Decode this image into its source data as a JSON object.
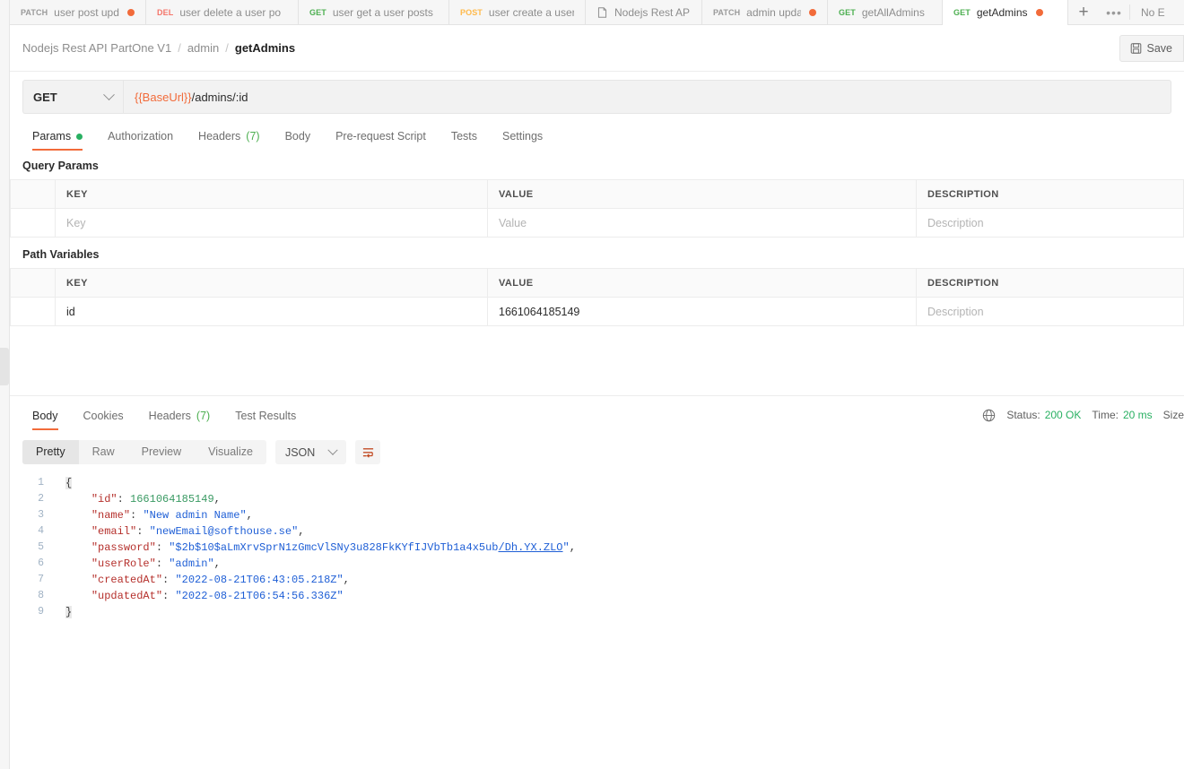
{
  "tabbar": {
    "tabs": [
      {
        "method": "PATCH",
        "method_class": "m-patch",
        "name": "user post updat",
        "unsaved": true,
        "doc": false,
        "active": false
      },
      {
        "method": "DEL",
        "method_class": "m-del",
        "name": "user delete a user po",
        "unsaved": false,
        "doc": false,
        "active": false
      },
      {
        "method": "GET",
        "method_class": "m-get",
        "name": "user get a user posts",
        "unsaved": false,
        "doc": false,
        "active": false
      },
      {
        "method": "POST",
        "method_class": "m-post",
        "name": "user create a user p",
        "unsaved": false,
        "doc": false,
        "active": false
      },
      {
        "method": "",
        "method_class": "",
        "name": "Nodejs Rest API Part",
        "unsaved": false,
        "doc": true,
        "active": false
      },
      {
        "method": "PATCH",
        "method_class": "m-patch",
        "name": "admin update",
        "unsaved": true,
        "doc": false,
        "active": false
      },
      {
        "method": "GET",
        "method_class": "m-get",
        "name": "getAllAdmins",
        "unsaved": false,
        "doc": false,
        "active": false
      },
      {
        "method": "GET",
        "method_class": "m-get",
        "name": "getAdmins",
        "unsaved": true,
        "doc": false,
        "active": true
      }
    ],
    "new_tab_label": "+",
    "more_label": "•••",
    "environment_label": "No E"
  },
  "breadcrumb": {
    "collection": "Nodejs Rest API PartOne V1",
    "folder": "admin",
    "request": "getAdmins",
    "separator": "/"
  },
  "toolbar": {
    "save_label": "Save"
  },
  "request": {
    "method": "GET",
    "url_variable": "{{BaseUrl}}",
    "url_path": "/admins/:id",
    "tabs": [
      {
        "label": "Params",
        "badge_dot": true,
        "count": "",
        "active": true
      },
      {
        "label": "Authorization",
        "badge_dot": false,
        "count": "",
        "active": false
      },
      {
        "label": "Headers",
        "badge_dot": false,
        "count": "(7)",
        "active": false
      },
      {
        "label": "Body",
        "badge_dot": false,
        "count": "",
        "active": false
      },
      {
        "label": "Pre-request Script",
        "badge_dot": false,
        "count": "",
        "active": false
      },
      {
        "label": "Tests",
        "badge_dot": false,
        "count": "",
        "active": false
      },
      {
        "label": "Settings",
        "badge_dot": false,
        "count": "",
        "active": false
      }
    ]
  },
  "query_params": {
    "title": "Query Params",
    "headers": {
      "key": "KEY",
      "value": "VALUE",
      "description": "DESCRIPTION"
    },
    "rows": [
      {
        "key": "Key",
        "key_placeholder": true,
        "value": "Value",
        "value_placeholder": true,
        "description": "Description",
        "desc_placeholder": true
      }
    ]
  },
  "path_variables": {
    "title": "Path Variables",
    "headers": {
      "key": "KEY",
      "value": "VALUE",
      "description": "DESCRIPTION"
    },
    "rows": [
      {
        "key": "id",
        "key_placeholder": false,
        "value": "1661064185149",
        "value_placeholder": false,
        "description": "Description",
        "desc_placeholder": true
      }
    ]
  },
  "response": {
    "tabs": [
      {
        "label": "Body",
        "count": "",
        "active": true
      },
      {
        "label": "Cookies",
        "count": "",
        "active": false
      },
      {
        "label": "Headers",
        "count": "(7)",
        "active": false
      },
      {
        "label": "Test Results",
        "count": "",
        "active": false
      }
    ],
    "status_label": "Status:",
    "status_value": "200 OK",
    "time_label": "Time:",
    "time_value": "20 ms",
    "size_label": "Size",
    "view_modes": [
      {
        "label": "Pretty",
        "active": true
      },
      {
        "label": "Raw",
        "active": false
      },
      {
        "label": "Preview",
        "active": false
      },
      {
        "label": "Visualize",
        "active": false
      }
    ],
    "format": "JSON",
    "body_lines": [
      {
        "n": "1",
        "segments": [
          {
            "t": "{",
            "c": "brace"
          }
        ]
      },
      {
        "n": "2",
        "segments": [
          {
            "t": "    ",
            "c": "p"
          },
          {
            "t": "\"id\"",
            "c": "k"
          },
          {
            "t": ": ",
            "c": "p"
          },
          {
            "t": "1661064185149",
            "c": "n"
          },
          {
            "t": ",",
            "c": "p"
          }
        ]
      },
      {
        "n": "3",
        "segments": [
          {
            "t": "    ",
            "c": "p"
          },
          {
            "t": "\"name\"",
            "c": "k"
          },
          {
            "t": ": ",
            "c": "p"
          },
          {
            "t": "\"New admin Name\"",
            "c": "s"
          },
          {
            "t": ",",
            "c": "p"
          }
        ]
      },
      {
        "n": "4",
        "segments": [
          {
            "t": "    ",
            "c": "p"
          },
          {
            "t": "\"email\"",
            "c": "k"
          },
          {
            "t": ": ",
            "c": "p"
          },
          {
            "t": "\"newEmail@softhouse.se\"",
            "c": "s"
          },
          {
            "t": ",",
            "c": "p"
          }
        ]
      },
      {
        "n": "5",
        "segments": [
          {
            "t": "    ",
            "c": "p"
          },
          {
            "t": "\"password\"",
            "c": "k"
          },
          {
            "t": ": ",
            "c": "p"
          },
          {
            "t": "\"$2b$10$aLmXrvSprN1zGmcVlSNy3u828FkKYfIJVbTb1a4x5ub",
            "c": "s"
          },
          {
            "t": "/Dh.YX.ZLO",
            "c": "lnk"
          },
          {
            "t": "\"",
            "c": "s"
          },
          {
            "t": ",",
            "c": "p"
          }
        ]
      },
      {
        "n": "6",
        "segments": [
          {
            "t": "    ",
            "c": "p"
          },
          {
            "t": "\"userRole\"",
            "c": "k"
          },
          {
            "t": ": ",
            "c": "p"
          },
          {
            "t": "\"admin\"",
            "c": "s"
          },
          {
            "t": ",",
            "c": "p"
          }
        ]
      },
      {
        "n": "7",
        "segments": [
          {
            "t": "    ",
            "c": "p"
          },
          {
            "t": "\"createdAt\"",
            "c": "k"
          },
          {
            "t": ": ",
            "c": "p"
          },
          {
            "t": "\"2022-08-21T06:43:05.218Z\"",
            "c": "s"
          },
          {
            "t": ",",
            "c": "p"
          }
        ]
      },
      {
        "n": "8",
        "segments": [
          {
            "t": "    ",
            "c": "p"
          },
          {
            "t": "\"updatedAt\"",
            "c": "k"
          },
          {
            "t": ": ",
            "c": "p"
          },
          {
            "t": "\"2022-08-21T06:54:56.336Z\"",
            "c": "s"
          }
        ]
      },
      {
        "n": "9",
        "segments": [
          {
            "t": "}",
            "c": "brace"
          }
        ]
      }
    ]
  },
  "colors": {
    "accent": "#f26b3a",
    "get": "#4caf50",
    "post": "#ffb94a",
    "delete": "#f4756a",
    "patch": "#9a9a9a",
    "success": "#29b062",
    "string": "#1f5fd6",
    "key": "#b5302c",
    "number": "#3a9a63"
  }
}
